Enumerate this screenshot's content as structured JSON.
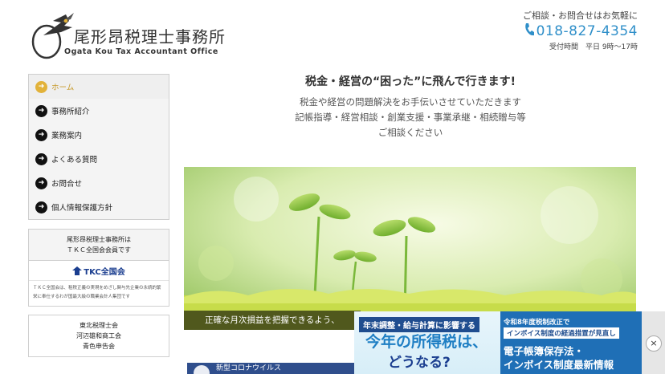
{
  "header": {
    "logo_title": "尾形昂税理士事務所",
    "logo_subtitle": "Ogata Kou Tax Accountant Office",
    "contact_lead": "ご相談・お問合せはお気軽に",
    "phone": "018-827-4354",
    "hours": "受付時間　平日 9時～17時"
  },
  "sidebar": {
    "nav": [
      {
        "label": "ホーム",
        "active": true
      },
      {
        "label": "事務所紹介",
        "active": false
      },
      {
        "label": "業務案内",
        "active": false
      },
      {
        "label": "よくある質問",
        "active": false
      },
      {
        "label": "お問合せ",
        "active": false
      },
      {
        "label": "個人情報保護方針",
        "active": false
      }
    ],
    "tkc": {
      "heading_line1": "尾形昂税理士事務所は",
      "heading_line2": "ＴＫＣ全国会会員です",
      "logo_text": "TKC全国会",
      "description": "ＴＫＣ全国会は、租税正義の実現をめざし関与先企業の永続的繁栄に奉仕するわが国最大級の職業会計人集団です"
    },
    "associations": [
      "東北税理士会",
      "河辺雄和商工会",
      "青色申告会"
    ]
  },
  "main": {
    "title": "税金・経営の“困った”に飛んで行きます!",
    "lines": [
      "税金や経営の問題解決をお手伝いさせていただきます",
      "記帳指導・経営相談・創業支援・事業承継・相続贈与等",
      "ご相談ください"
    ],
    "hero_caption": "正確な月次損益を把握できるよう、",
    "news_label": "新型コロナウイルス"
  },
  "ad": {
    "left_tag": "年末調整・給与計算に影響する",
    "left_main": "今年の所得税は、",
    "left_sub": "どうなる?",
    "right_tag": "令和8年度税制改正で",
    "right_badge": "インボイス制度の経過措置が見直し",
    "right_main1": "電子帳簿保存法・",
    "right_main2": "インボイス制度最新情報",
    "close": "×"
  },
  "colors": {
    "accent": "#2f8fc9",
    "active_nav": "#e2b23a",
    "ad_navy": "#1f4d8f"
  }
}
